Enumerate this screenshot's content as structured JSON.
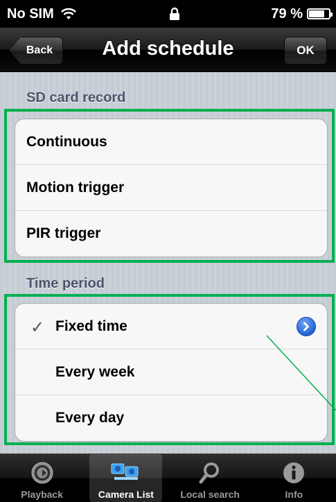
{
  "status_bar": {
    "carrier": "No SIM",
    "battery_text": "79 %",
    "battery_level": 0.79,
    "icons": [
      "wifi-icon",
      "lock-icon",
      "battery-icon"
    ]
  },
  "nav": {
    "back_label": "Back",
    "title": "Add schedule",
    "ok_label": "OK"
  },
  "sd_card": {
    "header": "SD card record",
    "items": [
      {
        "label": "Continuous"
      },
      {
        "label": "Motion trigger"
      },
      {
        "label": "PIR trigger"
      }
    ]
  },
  "time_period": {
    "header": "Time period",
    "items": [
      {
        "label": "Fixed time",
        "checked": true,
        "disclosure": true
      },
      {
        "label": "Every week"
      },
      {
        "label": "Every day"
      }
    ]
  },
  "tabs": [
    {
      "label": "Playback",
      "icon": "playback-icon"
    },
    {
      "label": "Camera List",
      "icon": "camera-list-icon",
      "active": true
    },
    {
      "label": "Local search",
      "icon": "search-icon"
    },
    {
      "label": "Info",
      "icon": "info-icon"
    }
  ],
  "colors": {
    "highlight": "#00b050",
    "accent_blue": "#2466d6",
    "section_text": "#4c566c"
  }
}
